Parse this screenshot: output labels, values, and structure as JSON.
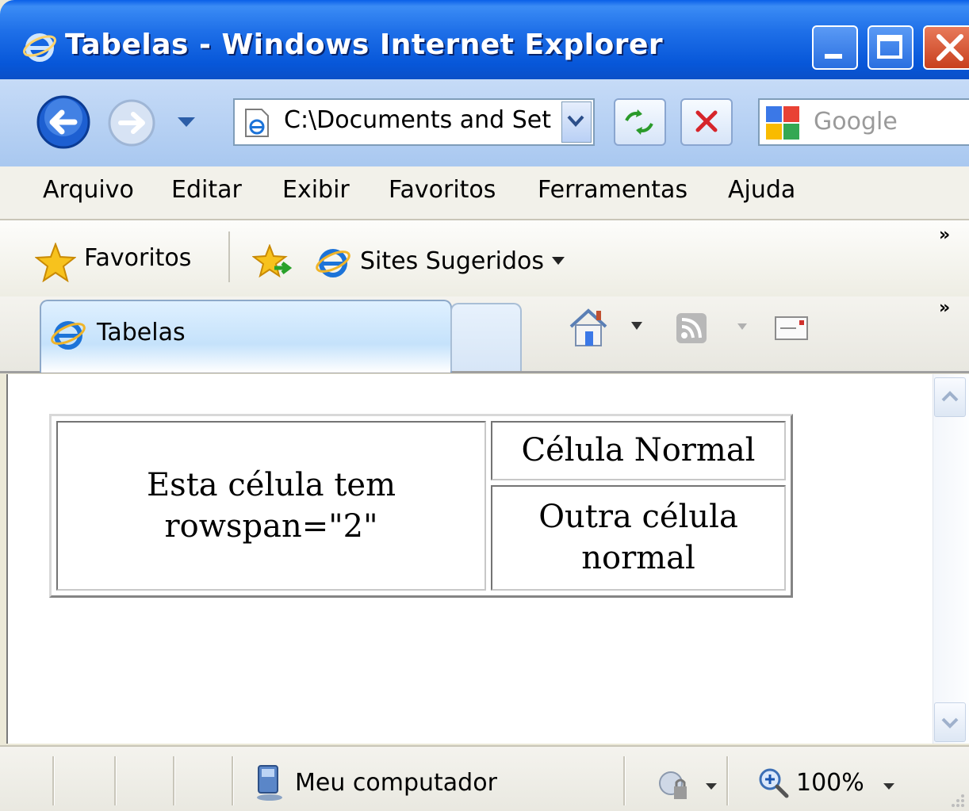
{
  "window": {
    "title": "Tabelas - Windows Internet Explorer"
  },
  "navbar": {
    "address": "C:\\Documents and Set",
    "search_placeholder": "Google"
  },
  "menu": {
    "items": [
      "Arquivo",
      "Editar",
      "Exibir",
      "Favoritos",
      "Ferramentas",
      "Ajuda"
    ]
  },
  "favorites_bar": {
    "favorites_label": "Favoritos",
    "suggested_sites_label": "Sites Sugeridos"
  },
  "tabs": {
    "active_label": "Tabelas"
  },
  "page": {
    "table": {
      "span_cell_line1": "Esta célula tem",
      "span_cell_line2": "rowspan=\"2\"",
      "cell_normal": "Célula Normal",
      "cell_other_line1": "Outra célula",
      "cell_other_line2": "normal"
    }
  },
  "statusbar": {
    "zone": "Meu computador",
    "zoom": "100%"
  },
  "colors": {
    "titlebar": "#0757d9",
    "navbar": "#c6dbf7",
    "close_button": "#c8401e"
  }
}
